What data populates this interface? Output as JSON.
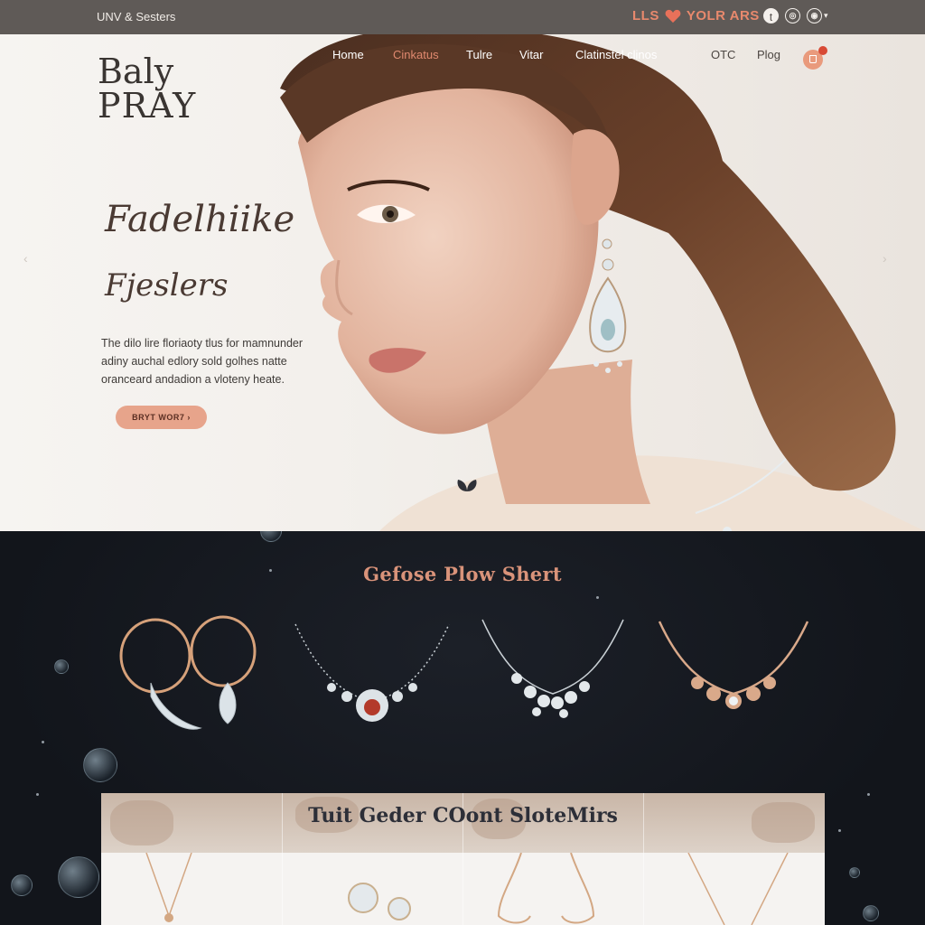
{
  "topbar": {
    "brand_text": "UNV & Sesters",
    "promo_left": "LLS",
    "promo_right": "YOLR ARS",
    "socials": [
      "instagram-icon",
      "pinterest-icon",
      "facebook-icon"
    ],
    "accent": "#e8896d"
  },
  "header": {
    "logo_line1": "Baly",
    "logo_line2": "PRAY",
    "nav": [
      "Home",
      "Cinkatus",
      "Tulre",
      "Vitar",
      "Clatinstel clinos",
      "OTC",
      "Plog"
    ],
    "active_nav": "Cinkatus"
  },
  "hero": {
    "headline_line1": "Fadelhiike",
    "headline_line2": "Fjeslers",
    "description": "The dilo lire floriaoty tlus for mamnunder adiny auchal edlory sold golhes natte oranceard andadion a vloteny heate.",
    "cta_label": "BRYT WOR7 ›",
    "cta_color": "#e7a48b"
  },
  "featured": {
    "title": "Gefose Plow Shert",
    "products": [
      "hoop-earrings",
      "ruby-necklace",
      "crystal-necklace",
      "rose-gold-necklace"
    ]
  },
  "gallery": {
    "title": "Tuit Geder COont SloteMirs"
  }
}
